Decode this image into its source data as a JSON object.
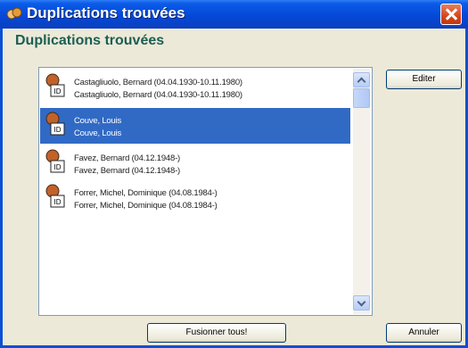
{
  "window": {
    "title": "Duplications trouvées"
  },
  "heading": "Duplications trouvées",
  "list": {
    "items": [
      {
        "line1": "Castagliuolo, Bernard (04.04.1930-10.11.1980)",
        "line2": "Castagliuolo, Bernard (04.04.1930-10.11.1980)",
        "selected": false
      },
      {
        "line1": "Couve, Louis",
        "line2": "Couve, Louis",
        "selected": true
      },
      {
        "line1": "Favez, Bernard (04.12.1948-)",
        "line2": "Favez, Bernard (04.12.1948-)",
        "selected": false
      },
      {
        "line1": "Forrer, Michel, Dominique (04.08.1984-)",
        "line2": "Forrer, Michel, Dominique (04.08.1984-)",
        "selected": false
      }
    ]
  },
  "buttons": {
    "edit": "Editer",
    "merge_all": "Fusionner tous!",
    "cancel": "Annuler"
  },
  "colors": {
    "titlebar": "#0548d8",
    "heading": "#1b5e52",
    "selection": "#316ac5"
  }
}
